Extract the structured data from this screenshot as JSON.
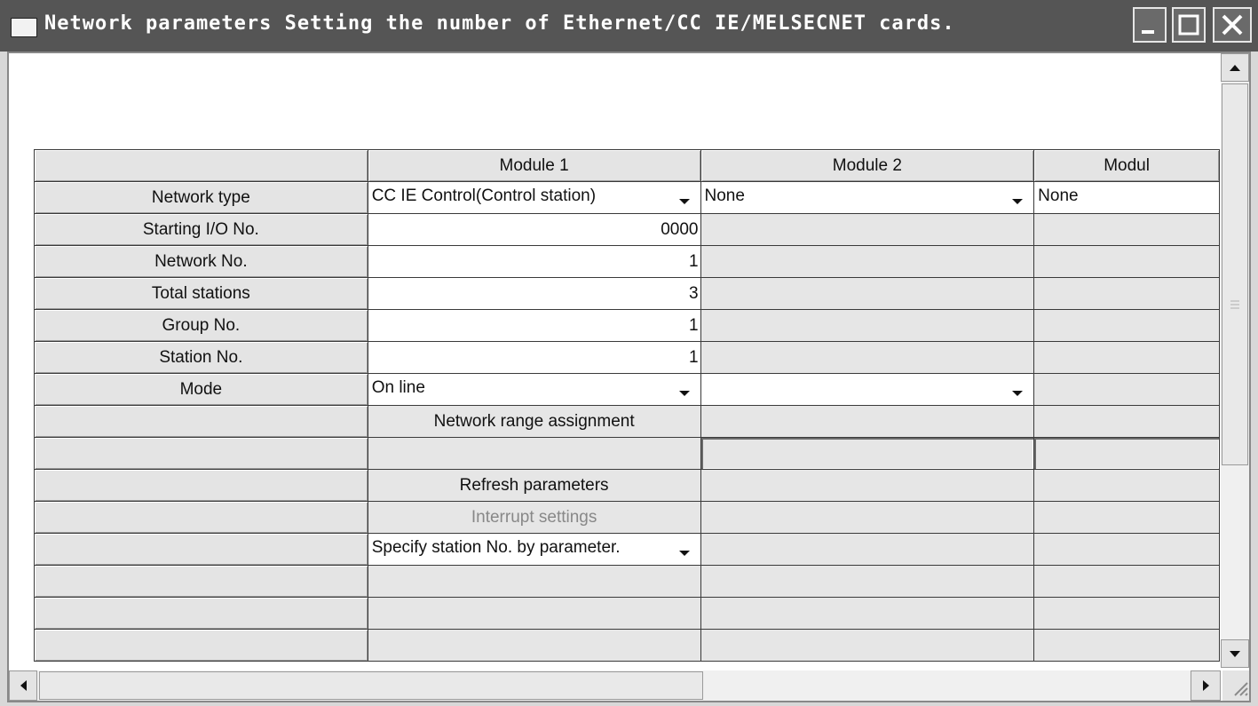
{
  "window": {
    "title": "Network parameters  Setting the number of Ethernet/CC IE/MELSECNET cards.",
    "controls": [
      "minimize-icon",
      "maximize-icon",
      "close-icon"
    ]
  },
  "table": {
    "columns": [
      "",
      "Module 1",
      "Module 2",
      "Modul"
    ],
    "rows": {
      "network_type": {
        "label": "Network type",
        "m1": "CC IE Control(Control station)",
        "m2": "None",
        "m3": "None"
      },
      "starting_io": {
        "label": "Starting I/O No.",
        "m1": "0000"
      },
      "network_no": {
        "label": "Network No.",
        "m1": "1"
      },
      "total_stations": {
        "label": "Total stations",
        "m1": "3"
      },
      "group_no": {
        "label": "Group No.",
        "m1": "1"
      },
      "station_no": {
        "label": "Station No.",
        "m1": "1"
      },
      "mode": {
        "label": "Mode",
        "m1": "On line",
        "m2": ""
      },
      "network_range": {
        "m1": "Network range assignment"
      },
      "refresh": {
        "m1": "Refresh parameters"
      },
      "interrupt": {
        "m1": "Interrupt settings"
      },
      "station_spec": {
        "m1": "Specify station No. by parameter."
      }
    }
  },
  "scroll": {
    "icons": [
      "scroll-up-icon",
      "scroll-down-icon",
      "scroll-left-icon",
      "scroll-right-icon",
      "resize-grip-icon"
    ]
  }
}
